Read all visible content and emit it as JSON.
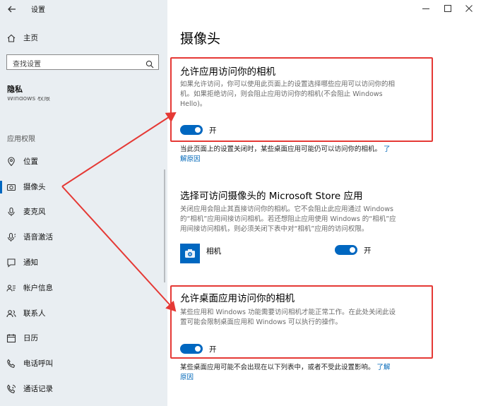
{
  "window": {
    "title": "设置",
    "minimize_icon": "minimize-icon",
    "maximize_icon": "maximize-icon",
    "close_icon": "close-icon"
  },
  "sidebar": {
    "home_label": "主页",
    "search_placeholder": "查找设置",
    "privacy_title": "隐私",
    "cut_off_item": "Windows 权限",
    "section_label": "应用权限",
    "items": [
      {
        "label": "位置",
        "icon": "location-icon"
      },
      {
        "label": "摄像头",
        "icon": "camera-icon",
        "selected": true
      },
      {
        "label": "麦克风",
        "icon": "microphone-icon"
      },
      {
        "label": "语音激活",
        "icon": "voice-activation-icon"
      },
      {
        "label": "通知",
        "icon": "notification-icon"
      },
      {
        "label": "帐户信息",
        "icon": "account-info-icon"
      },
      {
        "label": "联系人",
        "icon": "contacts-icon"
      },
      {
        "label": "日历",
        "icon": "calendar-icon"
      },
      {
        "label": "电话呼叫",
        "icon": "phone-call-icon"
      },
      {
        "label": "通话记录",
        "icon": "call-history-icon"
      }
    ]
  },
  "main": {
    "page_title": "摄像头",
    "section1": {
      "title": "允许应用访问你的相机",
      "desc_line1": "如果允许访问，你可以使用此页面上的设置选择哪些应用可以访问你的相",
      "desc_line2": "机。如果拒绝访问，则会阻止应用访问你的相机(不会阻止 Windows",
      "desc_line3": "Hello)。",
      "toggle_label": "开",
      "note_line1": "当此页面上的设置关闭时，某些桌面应用可能仍可以访问你的相机。",
      "note_link1": "了",
      "note_link2": "解原因"
    },
    "section2": {
      "title": "选择可访问摄像头的 Microsoft Store 应用",
      "desc_line1": "关闭应用会阻止其直接访问你的相机。它不会阻止此应用通过 Windows",
      "desc_line2": "的“相机”应用间接访问相机。若还想阻止应用使用 Windows 的“相机”应",
      "desc_line3": "用间接访问相机，则必须关闭下表中对“相机”应用的访问权限。",
      "app_name": "相机",
      "app_toggle_label": "开"
    },
    "section3": {
      "title": "允许桌面应用访问你的相机",
      "desc_line1": "某些应用和 Windows 功能需要访问相机才能正常工作。在此处关闭此设",
      "desc_line2": "置可能会限制桌面应用和 Windows 可以执行的操作。",
      "toggle_label": "开",
      "note_line1": "某些桌面应用可能不会出现在以下列表中，或者不受此设置影响。",
      "note_link1": "了解",
      "note_link2": "原因"
    }
  },
  "colors": {
    "accent": "#0067c0",
    "highlight": "#e53935",
    "sidebar_bg": "#e9eef2"
  }
}
